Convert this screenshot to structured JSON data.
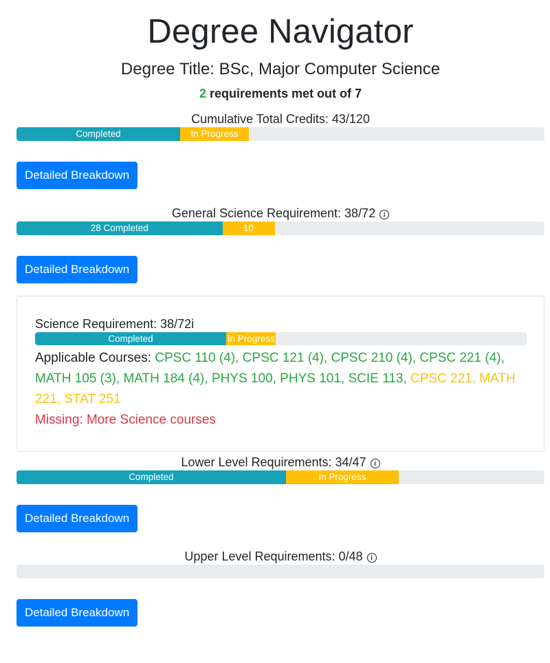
{
  "header": {
    "title": "Degree Navigator",
    "degree_title": "Degree Title: BSc, Major Computer Science",
    "summary": {
      "met": "2",
      "text": " requirements met out of 7"
    }
  },
  "cumulative": {
    "label": "Cumulative Total Credits: 43/120",
    "completed_label": "Completed",
    "in_progress_label": "In Progress",
    "completed_fraction": 0.31,
    "in_progress_fraction": 0.13,
    "button": "Detailed Breakdown"
  },
  "general_science": {
    "label": "General Science Requirement: 38/72",
    "completed_label": "28 Completed",
    "in_progress_label": "10",
    "completed_fraction": 0.39,
    "in_progress_fraction": 0.099,
    "button": "Detailed Breakdown",
    "card": {
      "label": "Science Requirement: 38/72",
      "completed_label": "Completed",
      "in_progress_label": "In Progress",
      "completed_fraction": 0.389,
      "in_progress_fraction": 0.101,
      "applicable_prefix": "Applicable Courses: ",
      "completed_courses": "CPSC 110 (4), CPSC 121 (4), CPSC 210 (4), CPSC 221 (4), MATH 105 (3), MATH 184 (4), PHYS 100, PHYS 101, SCIE 113,",
      "in_progress_courses": " CPSC 221, MATH 221, STAT 251",
      "missing": "Missing: More Science courses"
    }
  },
  "lower_level": {
    "label": "Lower Level Requirements: 34/47",
    "completed_label": "Completed",
    "in_progress_label": "In Progress",
    "completed_fraction": 0.51,
    "in_progress_fraction": 0.214,
    "button": "Detailed Breakdown"
  },
  "upper_level": {
    "label": "Upper Level Requirements: 0/48",
    "completed_fraction": 0,
    "in_progress_fraction": 0,
    "button": "Detailed Breakdown"
  },
  "icons": {
    "info": "info-circle-icon"
  },
  "colors": {
    "completed": "#17a2b8",
    "in_progress": "#ffc107",
    "button": "#007bff",
    "met": "#28a745",
    "missing": "#dc3545"
  }
}
